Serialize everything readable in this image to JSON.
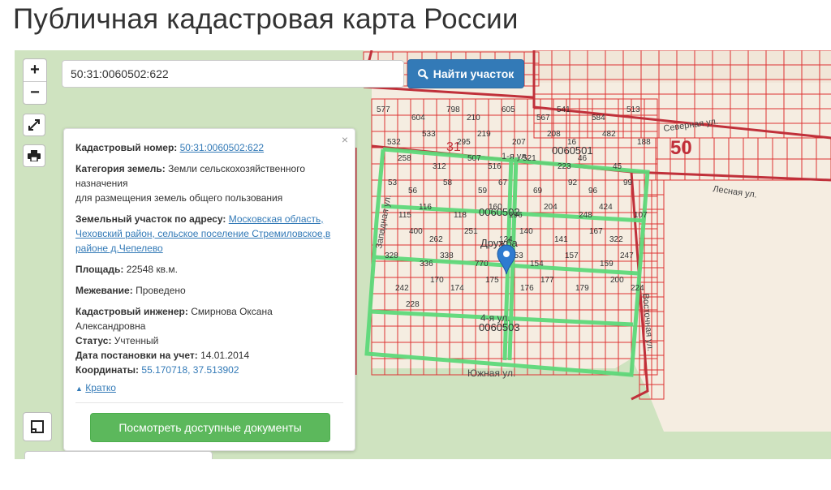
{
  "header": {
    "title": "Публичная кадастровая карта России"
  },
  "search": {
    "value": "50:31:0060502:622",
    "button_label": "Найти участок"
  },
  "controls": {
    "zoom_in": "+",
    "zoom_out": "−"
  },
  "info": {
    "close": "×",
    "cadastral_number_label": "Кадастровый номер:",
    "cadastral_number": "50:31:0060502:622",
    "land_category_label": "Категория земель:",
    "land_category": "Земли сельскохозяйственного назначения",
    "purpose": "для размещения земель общего пользования",
    "address_label": "Земельный участок по адресу:",
    "address": "Московская область, Чеховский район, сельское поселение Стремиловское,в районе д.Чепелево",
    "area_label": "Площадь:",
    "area": "22548 кв.м.",
    "survey_label": "Межевание:",
    "survey": "Проведено",
    "engineer_label": "Кадастровый инженер:",
    "engineer": "Смирнова Оксана Александровна",
    "status_label": "Статус:",
    "status": "Учтенный",
    "date_label": "Дата постановки на учет:",
    "date": "14.01.2014",
    "coords_label": "Координаты:",
    "coords": "55.170718, 37.513902",
    "brief_link": "Кратко",
    "docs_button": "Посмотреть доступные документы"
  },
  "map_labels": {
    "district_big": "50",
    "district_31": "31",
    "quarter_501": "0060501",
    "quarter_502": "0060502",
    "quarter_503": "0060503",
    "village": "Дружба",
    "street_south": "Южная ул.",
    "street_4": "4-я ул.",
    "street_1": "1-я ул.",
    "street_north": "Северная ул.",
    "street_west": "Западная ул.",
    "street_east": "Восточная ул.",
    "street_lesnaya": "Лесная ул.",
    "parcels": [
      "577",
      "604",
      "798",
      "210",
      "605",
      "567",
      "541",
      "584",
      "513",
      "532",
      "533",
      "295",
      "219",
      "207",
      "208",
      "16",
      "482",
      "188",
      "258",
      "312",
      "507",
      "516",
      "521",
      "223",
      "46",
      "45",
      "53",
      "56",
      "58",
      "59",
      "67",
      "69",
      "92",
      "96",
      "99",
      "115",
      "116",
      "118",
      "160",
      "196",
      "204",
      "248",
      "424",
      "107",
      "400",
      "262",
      "251",
      "124",
      "140",
      "141",
      "167",
      "322",
      "328",
      "336",
      "338",
      "770",
      "153",
      "154",
      "157",
      "159",
      "247",
      "242",
      "170",
      "174",
      "175",
      "176",
      "177",
      "179",
      "200",
      "224",
      "228"
    ]
  }
}
